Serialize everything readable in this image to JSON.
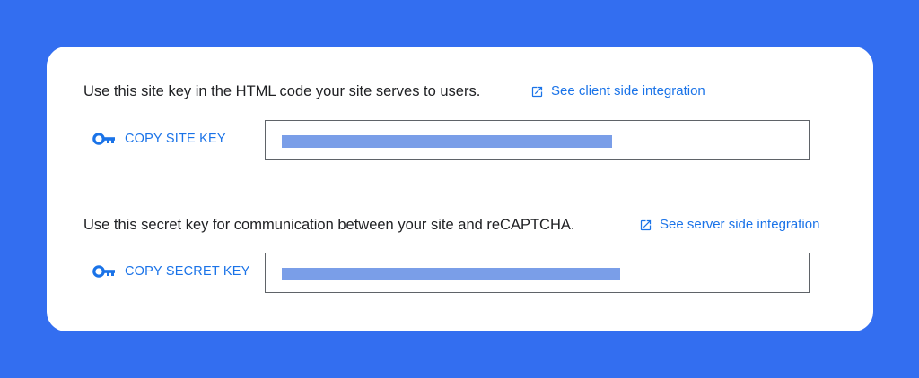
{
  "site_key_section": {
    "description": "Use this site key in the HTML code your site serves to users.",
    "link_label": "See client side integration",
    "copy_label": "COPY SITE KEY"
  },
  "secret_key_section": {
    "description": "Use this secret key for communication between your site and reCAPTCHA.",
    "link_label": "See server side integration",
    "copy_label": "COPY SECRET KEY"
  },
  "icons": {
    "key": "key-icon",
    "external_link": "open-in-new-icon"
  },
  "colors": {
    "background": "#336ef0",
    "card": "#ffffff",
    "accent": "#1a73e8",
    "redaction": "#7a9ee8"
  }
}
